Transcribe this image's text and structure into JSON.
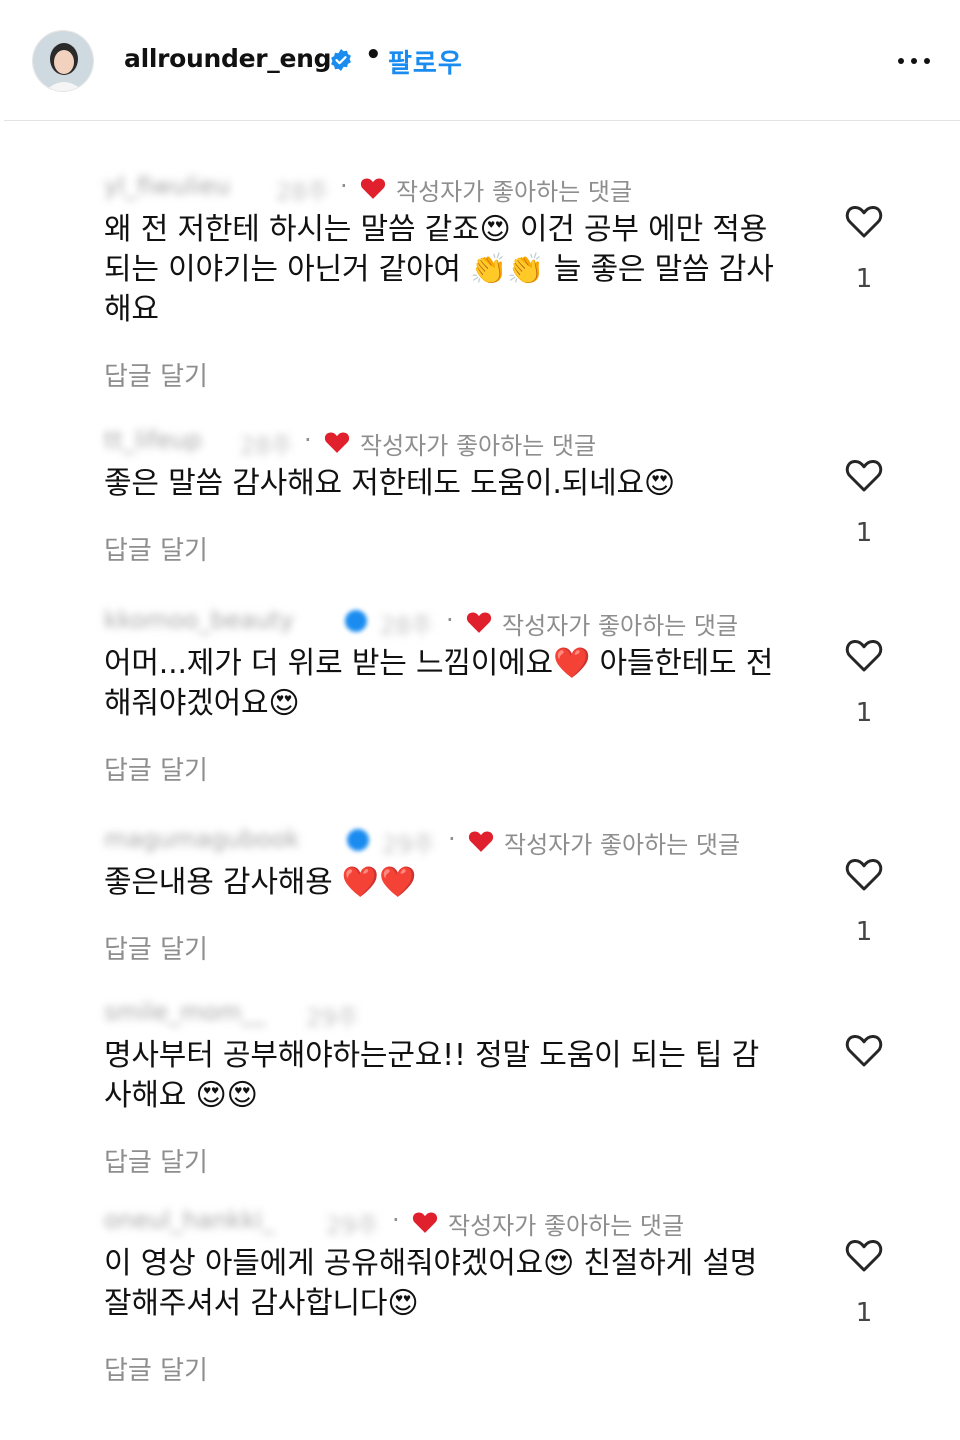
{
  "header": {
    "username": "allrounder_eng",
    "separator": "•",
    "follow_label": "팔로우",
    "verified_color": "#1a8cf0"
  },
  "liked_color": "#e0202c",
  "comments": [
    {
      "username": "yl_fiwulieu",
      "time": "28주",
      "liked_label": "작성자가 좋아하는 댓글",
      "text": "왜 전 저한테 하시는 말씀 같죠😍 이건 공부 에만 적용되는 이야기는 아닌거 같아여 👏👏 늘 좋은 말씀 감사해요",
      "reply_label": "답글 달기",
      "like_count": "1"
    },
    {
      "username": "tt_lifeup",
      "time": "28주",
      "liked_label": "작성자가 좋아하는 댓글",
      "text": "좋은 말씀 감사해요 저한테도 도움이.되네요😍",
      "reply_label": "답글 달기",
      "like_count": "1"
    },
    {
      "username": "kkomoo_beauty",
      "time": "28주",
      "liked_label": "작성자가 좋아하는 댓글",
      "text": "어머...제가 더 위로 받는 느낌이에요❤️ 아들한테도 전해줘야겠어요😍",
      "reply_label": "답글 달기",
      "like_count": "1"
    },
    {
      "username": "magumagubook",
      "time": "29주",
      "liked_label": "작성자가 좋아하는 댓글",
      "text": "좋은내용 감사해용 ❤️❤️",
      "reply_label": "답글 달기",
      "like_count": "1"
    },
    {
      "username": "smile_mom__",
      "time": "29주",
      "text": "명사부터 공부해야하는군요!! 정말 도움이 되는 팁 감사해요 😍😍",
      "reply_label": "답글 달기"
    },
    {
      "username": "oneul_hankki_",
      "time": "29주",
      "liked_label": "작성자가 좋아하는 댓글",
      "text": "이 영상 아들에게 공유해줘야겠어요😍 친절하게 설명 잘해주셔서 감사합니다😍",
      "reply_label": "답글 달기",
      "like_count": "1"
    }
  ]
}
